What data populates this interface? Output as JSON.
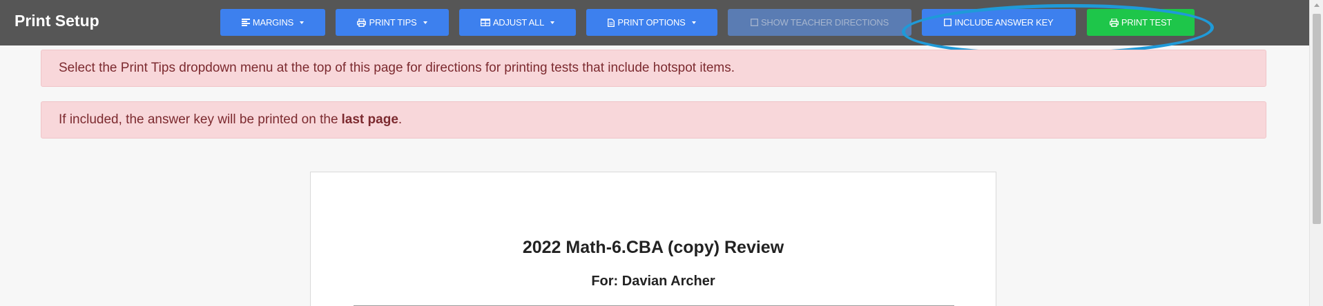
{
  "app": {
    "title": "Print Setup"
  },
  "toolbar": {
    "margins": "MARGINS",
    "print_tips": "PRINT TIPS",
    "adjust_all": "ADJUST ALL",
    "print_options": "PRINT OPTIONS",
    "show_teacher_directions": "SHOW TEACHER DIRECTIONS",
    "include_answer_key": "INCLUDE ANSWER KEY",
    "print_test": "PRINT TEST"
  },
  "colors": {
    "toolbar_bg": "#565656",
    "button_blue": "#3d80ee",
    "button_green": "#1ec64a",
    "alert_bg": "#f8d7da",
    "highlight_ring": "#1f9ad8"
  },
  "alerts": [
    {
      "text": "Select the Print Tips dropdown menu at the top of this page for directions for printing tests that include hotspot items."
    },
    {
      "text": "If included, the answer key will be printed on the",
      "bold": "last page",
      "suffix": "."
    }
  ],
  "document": {
    "title": "2022 Math-6.CBA (copy) Review",
    "for_line": "For: Davian Archer"
  },
  "icons": [
    "align-left-icon",
    "print-icon",
    "table-icon",
    "file-icon",
    "checkbox-icon",
    "caret-down-icon"
  ]
}
